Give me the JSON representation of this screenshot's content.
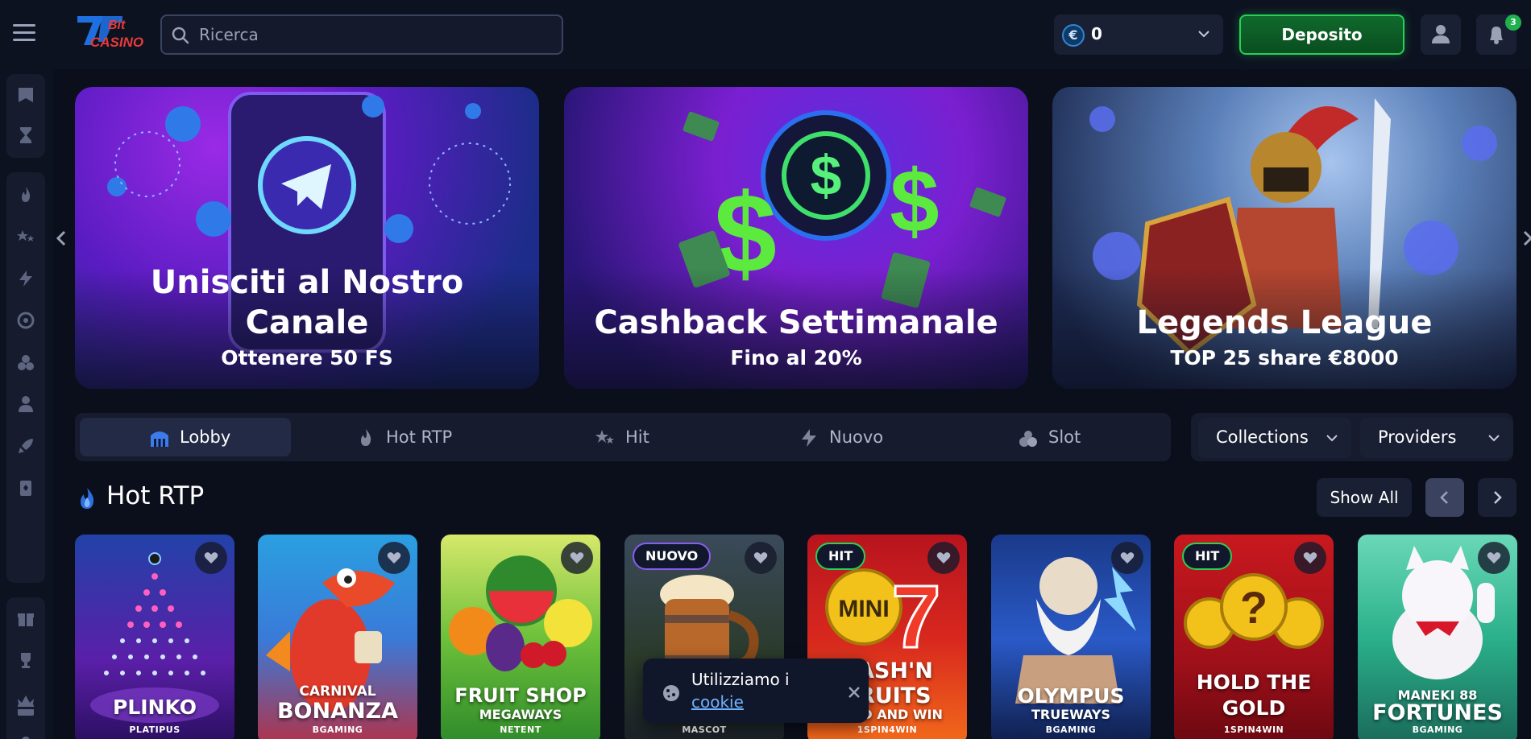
{
  "header": {
    "logo_alt": "7Bit Casino",
    "search": {
      "placeholder": "Ricerca"
    },
    "balance": {
      "currency_symbol": "€",
      "amount": "0"
    },
    "deposit_label": "Deposito",
    "notifications_count": "3"
  },
  "banners": [
    {
      "title_line1": "Unisciti al Nostro",
      "title_line2": "Canale",
      "subtitle": "Ottenere 50 FS"
    },
    {
      "title": "Cashback Settimanale",
      "subtitle": "Fino al 20%"
    },
    {
      "title": "Legends League",
      "subtitle": "TOP 25 share €8000"
    }
  ],
  "tabs": [
    {
      "label": "Lobby",
      "icon": "lobby-icon",
      "active": true
    },
    {
      "label": "Hot RTP",
      "icon": "flame-icon",
      "active": false
    },
    {
      "label": "Hit",
      "icon": "stars-icon",
      "active": false
    },
    {
      "label": "Nuovo",
      "icon": "lightning-icon",
      "active": false
    },
    {
      "label": "Slot",
      "icon": "cherries-icon",
      "active": false
    }
  ],
  "filters": {
    "collections_label": "Collections",
    "providers_label": "Providers"
  },
  "section": {
    "title": "Hot RTP",
    "show_all_label": "Show All"
  },
  "games": [
    {
      "name": "PLINKO",
      "provider": "PLATIPUS",
      "tag": ""
    },
    {
      "name_small": "CARNIVAL",
      "name": "BONANZA",
      "provider": "BGAMING",
      "tag": ""
    },
    {
      "name": "FRUIT SHOP",
      "name_small": "MEGAWAYS",
      "provider": "NETENT",
      "tag": ""
    },
    {
      "name": "",
      "provider": "MASCOT",
      "tag": "NUOVO"
    },
    {
      "name": "CASH'N FRUITS",
      "name_small": "HOLD AND WIN",
      "provider": "1SPIN4WIN",
      "tag": "HIT"
    },
    {
      "name": "OLYMPUS",
      "name_small": "TRUEWAYS",
      "provider": "BGAMING",
      "tag": ""
    },
    {
      "name": "HOLD THE GOLD",
      "provider": "1SPIN4WIN",
      "tag": "HIT"
    },
    {
      "name_small": "MANEKI 88",
      "name": "FORTUNES",
      "provider": "BGAMING",
      "tag": ""
    }
  ],
  "cookie": {
    "text": "Utilizziamo i",
    "link": "cookie"
  },
  "colors": {
    "accent_green": "#25d157",
    "background": "#0b0f1c",
    "panel": "#161c2d"
  }
}
